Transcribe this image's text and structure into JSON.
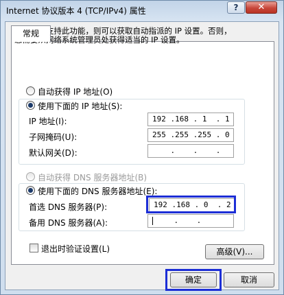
{
  "window": {
    "title": "Internet 协议版本 4 (TCP/IPv4) 属性",
    "help_label": "?",
    "close_label": "✕"
  },
  "tab": {
    "label": "常规"
  },
  "description": {
    "line1": "如果网络支持此功能，则可以获取自动指派的 IP 设置。否则，",
    "line2": "您需要从网络系统管理员处获得适当的 IP 设置。"
  },
  "ip_mode": {
    "auto_label": "自动获得 IP 地址(O)",
    "manual_label": "使用下面的 IP 地址(S):"
  },
  "ip_fields": {
    "address_label": "IP 地址(I):",
    "address_value": "192 .168 . 1  . 1",
    "subnet_label": "子网掩码(U):",
    "subnet_value": "255 .255 .255 . 0",
    "gateway_label": "默认网关(D):",
    "gateway_value": "    .    .    .   "
  },
  "dns_mode": {
    "auto_label": "自动获得 DNS 服务器地址(B)",
    "manual_label": "使用下面的 DNS 服务器地址(E):"
  },
  "dns_fields": {
    "preferred_label": "首选 DNS 服务器(P):",
    "preferred_value": "192 .168 . 0  . 2",
    "alternate_label": "备用 DNS 服务器(A):",
    "alternate_value": "    .    .    "
  },
  "validate_on_exit": {
    "label": "退出时验证设置(L)",
    "checked": false
  },
  "buttons": {
    "advanced": "高级(V)...",
    "ok": "确定",
    "cancel": "取消"
  },
  "colors": {
    "highlight_border": "#1c2ed6",
    "close_button": "#c8463a",
    "title_bar": "#c2d4e8"
  }
}
